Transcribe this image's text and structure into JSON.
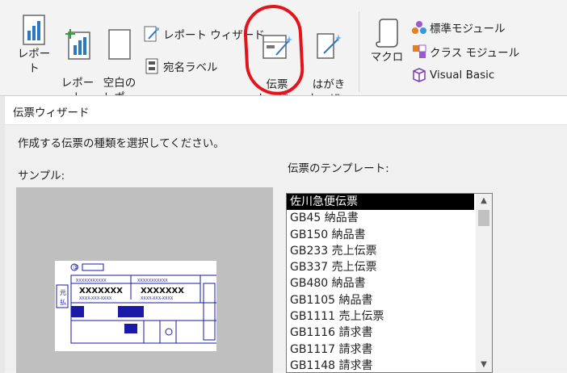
{
  "ribbon": {
    "report_label": "レポート",
    "report_design_label": "レポート\nデザイン",
    "blank_report_label": "空白の\nレポート",
    "report_wizard_label": "レポート ウィザード",
    "labels_label": "宛名ラベル",
    "slip_wizard_label": "伝票\nウィザード",
    "postcard_wizard_label": "はがき\nウィザード",
    "macro_label": "マクロ",
    "standard_module_label": "標準モジュール",
    "class_module_label": "クラス モジュール",
    "visual_basic_label": "Visual Basic"
  },
  "dialog": {
    "title": "伝票ウィザード",
    "instruction": "作成する伝票の種類を選択してください。",
    "sample_label": "サンプル:",
    "templates_label": "伝票のテンプレート:",
    "sample_slip": {
      "mark": "①",
      "moto": "元",
      "barai": "払",
      "code1": "XXXXXXXXXXX",
      "code2": "XXXXXXXXXXX",
      "big1": "XXXXXXX",
      "big2": "XXXXXXX",
      "small1": "XXXX-XXX-XXXX",
      "small2": "XXXX-XXX-XXXX"
    },
    "templates": [
      "佐川急便伝票",
      "GB45 納品書",
      "GB150 納品書",
      "GB233 売上伝票",
      "GB337 売上伝票",
      "GB480 納品書",
      "GB1105 納品書",
      "GB1111 売上伝票",
      "GB1116 請求書",
      "GB1117 請求書",
      "GB1148 請求書"
    ],
    "selected_template": "佐川急便伝票"
  }
}
